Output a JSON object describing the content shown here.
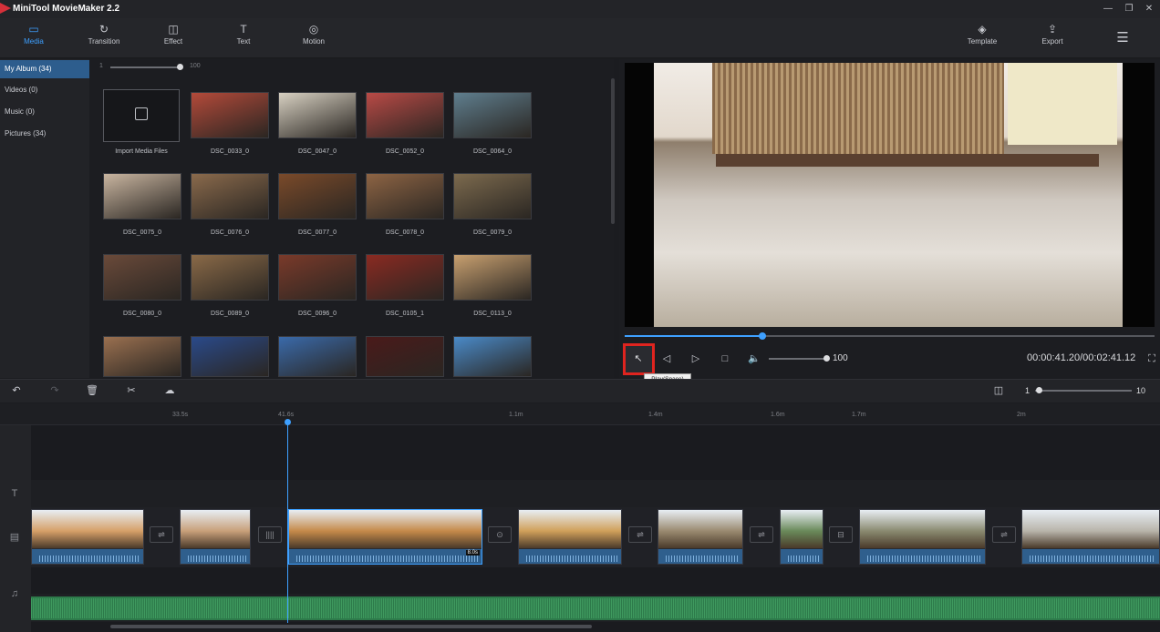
{
  "app": {
    "title": "MiniTool MovieMaker 2.2"
  },
  "window": {
    "minimize": "—",
    "maximize": "❐",
    "close": "✕"
  },
  "toolbar": {
    "tabs": [
      {
        "label": "Media",
        "icon": "folder-icon",
        "glyph": "▭",
        "active": true
      },
      {
        "label": "Transition",
        "icon": "transition-icon",
        "glyph": "↻",
        "active": false
      },
      {
        "label": "Effect",
        "icon": "effect-icon",
        "glyph": "◫",
        "active": false
      },
      {
        "label": "Text",
        "icon": "text-icon",
        "glyph": "T",
        "active": false
      },
      {
        "label": "Motion",
        "icon": "motion-icon",
        "glyph": "◎",
        "active": false
      }
    ],
    "template": {
      "label": "Template",
      "glyph": "◈"
    },
    "export": {
      "label": "Export",
      "glyph": "⇪"
    },
    "menu_glyph": "☰"
  },
  "sidebar": {
    "albums": [
      {
        "label": "My Album  (34)",
        "active": true
      },
      {
        "label": "Videos  (0)",
        "active": false
      },
      {
        "label": "Music  (0)",
        "active": false
      },
      {
        "label": "Pictures  (34)",
        "active": false
      }
    ]
  },
  "media": {
    "zoom_min": "1",
    "zoom_max": "100",
    "import_label": "Import Media Files",
    "items": [
      {
        "label": "DSC_0033_0",
        "color": "#b44a3a"
      },
      {
        "label": "DSC_0047_0",
        "color": "#d8d1c2"
      },
      {
        "label": "DSC_0052_0",
        "color": "#b94a46"
      },
      {
        "label": "DSC_0064_0",
        "color": "#5f7e8e"
      },
      {
        "label": "DSC_0075_0",
        "color": "#c9b5a0"
      },
      {
        "label": "DSC_0076_0",
        "color": "#8a6a4c"
      },
      {
        "label": "DSC_0077_0",
        "color": "#7a4a2a"
      },
      {
        "label": "DSC_0078_0",
        "color": "#8d6444"
      },
      {
        "label": "DSC_0079_0",
        "color": "#7c6a4e"
      },
      {
        "label": "DSC_0080_0",
        "color": "#6a4a3a"
      },
      {
        "label": "DSC_0089_0",
        "color": "#8a6a48"
      },
      {
        "label": "DSC_0096_0",
        "color": "#7a3a2a"
      },
      {
        "label": "DSC_0105_1",
        "color": "#8a2a22"
      },
      {
        "label": "DSC_0113_0",
        "color": "#c8a070"
      },
      {
        "label": "",
        "color": "#9a7050"
      },
      {
        "label": "",
        "color": "#2a4a8a"
      },
      {
        "label": "",
        "color": "#3a6aaa"
      },
      {
        "label": "",
        "color": "#4a1a1a"
      },
      {
        "label": "",
        "color": "#4a8ac8"
      }
    ]
  },
  "player": {
    "progress": 0.26,
    "volume": "100",
    "timecode": "00:00:41.20/00:02:41.12",
    "tooltip": "Play(Space)",
    "controls": {
      "pointer": "↖",
      "prev": "◁",
      "play": "▷",
      "stop": "□",
      "volume": "🔈",
      "fullscreen": "⛶"
    }
  },
  "timeline_toolbar": {
    "undo": "↶",
    "redo": "↷",
    "delete": "🗑",
    "split": "✂",
    "audio": "☁",
    "fit": "◫",
    "zoom_min": "1",
    "zoom_max": "10"
  },
  "ruler": {
    "labels": [
      "33.5s",
      "41.6s",
      "1.1m",
      "1.4m",
      "1.6m",
      "1.7m",
      "2m"
    ]
  },
  "tracks": {
    "text_icon": "T",
    "video_icon": "▤",
    "music_icon": "♫"
  },
  "clips": [
    {
      "name": "clip-1",
      "color": "#d6a068",
      "selected": false
    },
    {
      "name": "clip-2",
      "color": "#c8a07a",
      "selected": false
    },
    {
      "name": "clip-3",
      "color": "#c58a4a",
      "selected": true,
      "badge": "8.0s"
    },
    {
      "name": "clip-4",
      "color": "#d0a05a",
      "selected": false
    },
    {
      "name": "clip-5",
      "color": "#9a8a70",
      "selected": false
    },
    {
      "name": "clip-6",
      "color": "#6a8a5a",
      "selected": false
    },
    {
      "name": "clip-7",
      "color": "#8a8a70",
      "selected": false
    },
    {
      "name": "clip-8",
      "color": "#b8b4aa",
      "selected": false
    }
  ]
}
